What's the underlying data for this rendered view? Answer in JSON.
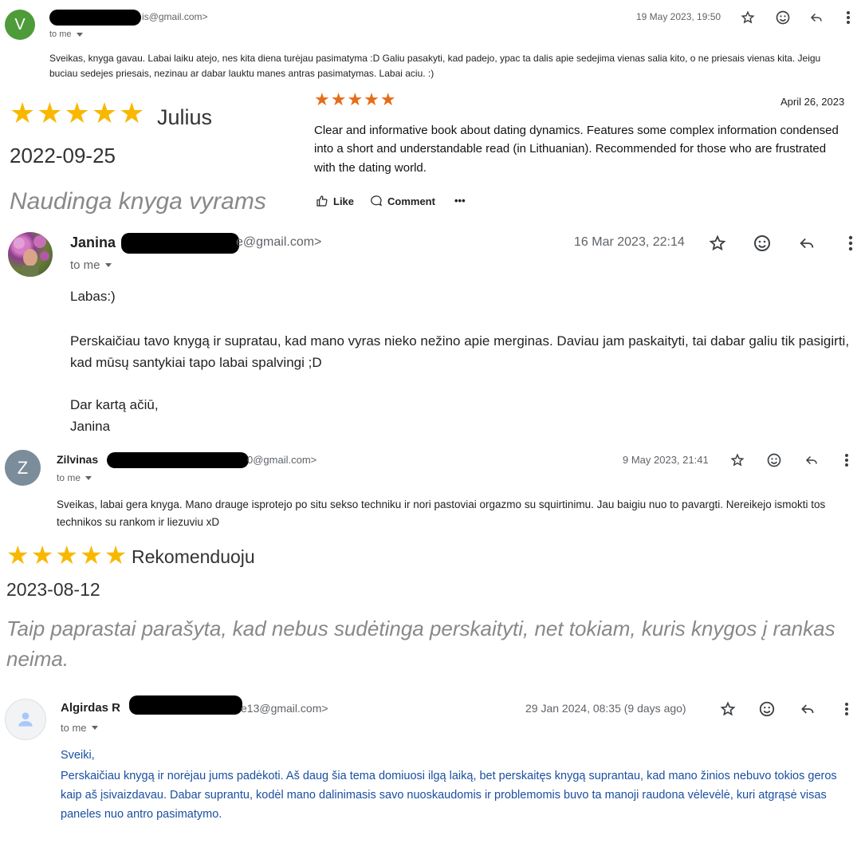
{
  "email1": {
    "avatar_letter": "V",
    "avatar_color": "#4e9b3a",
    "sender_email": "is@gmail.com>",
    "date": "19 May 2023, 19:50",
    "to_me": "to me",
    "body": "Sveikas, knyga gavau. Labai laiku atejo, nes kita diena turėjau pasimatyma :D Galiu pasakyti, kad padejo, ypac ta dalis apie sedejima vienas salia kito, o ne priesais vienas kita. Jeigu buciau sedejes priesais, nezinau ar dabar lauktu manes antras pasimatymas. Labai aciu. :)"
  },
  "review_julius": {
    "stars": "★★★★★",
    "rating": 5,
    "name": "Julius",
    "date": "2022-09-25",
    "title": "Naudinga knyga vyrams"
  },
  "review_english": {
    "stars": "★★★★★",
    "rating": 5,
    "date": "April 26, 2023",
    "text": "Clear and informative book about dating dynamics. Features some complex information condensed into a short and understandable read (in Lithuanian). Recommended for those who are frustrated with the dating world.",
    "like_label": "Like",
    "comment_label": "Comment",
    "more_label": "•••"
  },
  "email2": {
    "sender_name": "Janina",
    "sender_email": "e@gmail.com>",
    "date": "16 Mar 2023, 22:14",
    "to_me": "to me",
    "greeting": "Labas:)",
    "body": "Perskaičiau tavo knygą ir supratau, kad mano vyras nieko nežino apie merginas. Daviau jam paskaityti, tai dabar galiu tik pasigirti, kad mūsų santykiai tapo labai spalvingi ;D",
    "closing": "Dar kartą ačiū,",
    "signature": "Janina"
  },
  "email3": {
    "avatar_letter": "Z",
    "avatar_color": "#7b8c9a",
    "sender_name": "Zilvinas",
    "sender_email": "0@gmail.com>",
    "date": "9 May 2023, 21:41",
    "to_me": "to me",
    "body": "Sveikas, labai gera knyga. Mano drauge isprotejo po situ sekso techniku ir nori pastoviai orgazmo su squirtinimu. Jau baigiu nuo to pavargti. Nereikejo ismokti tos technikos su rankom ir liezuviu xD"
  },
  "review_rekomenduoju": {
    "stars": "★★★★★",
    "rating": 5,
    "name": "Rekomenduoju",
    "date": "2023-08-12",
    "text": "Taip paprastai parašyta, kad nebus sudėtinga perskaityti, net tokiam, kuris knygos į rankas neima."
  },
  "email4": {
    "sender_name": "Algirdas R",
    "sender_email": "e13@gmail.com>",
    "date": "29 Jan 2024, 08:35 (9 days ago)",
    "to_me": "to me",
    "greeting": "Sveiki,",
    "body": "Perskaičiau knygą ir norėjau jums padėkoti. Aš daug šia tema domiuosi ilgą laiką, bet perskaitęs knygą suprantau, kad mano žinios nebuvo tokios geros kaip aš įsivaizdavau. Dabar suprantu, kodėl mano dalinimasis savo nuoskaudomis ir problemomis buvo ta manoji raudona vėlevėlė, kuri atgrąsė visas paneles nuo antro pasimatymo."
  },
  "icons": [
    "star-icon",
    "emoji-icon",
    "reply-icon",
    "more-vert-icon",
    "thumbs-up-icon",
    "comment-icon",
    "person-icon"
  ],
  "colors": {
    "star_yellow": "#f9b800",
    "star_orange": "#e66c16",
    "link_blue": "#1a4fa0"
  }
}
